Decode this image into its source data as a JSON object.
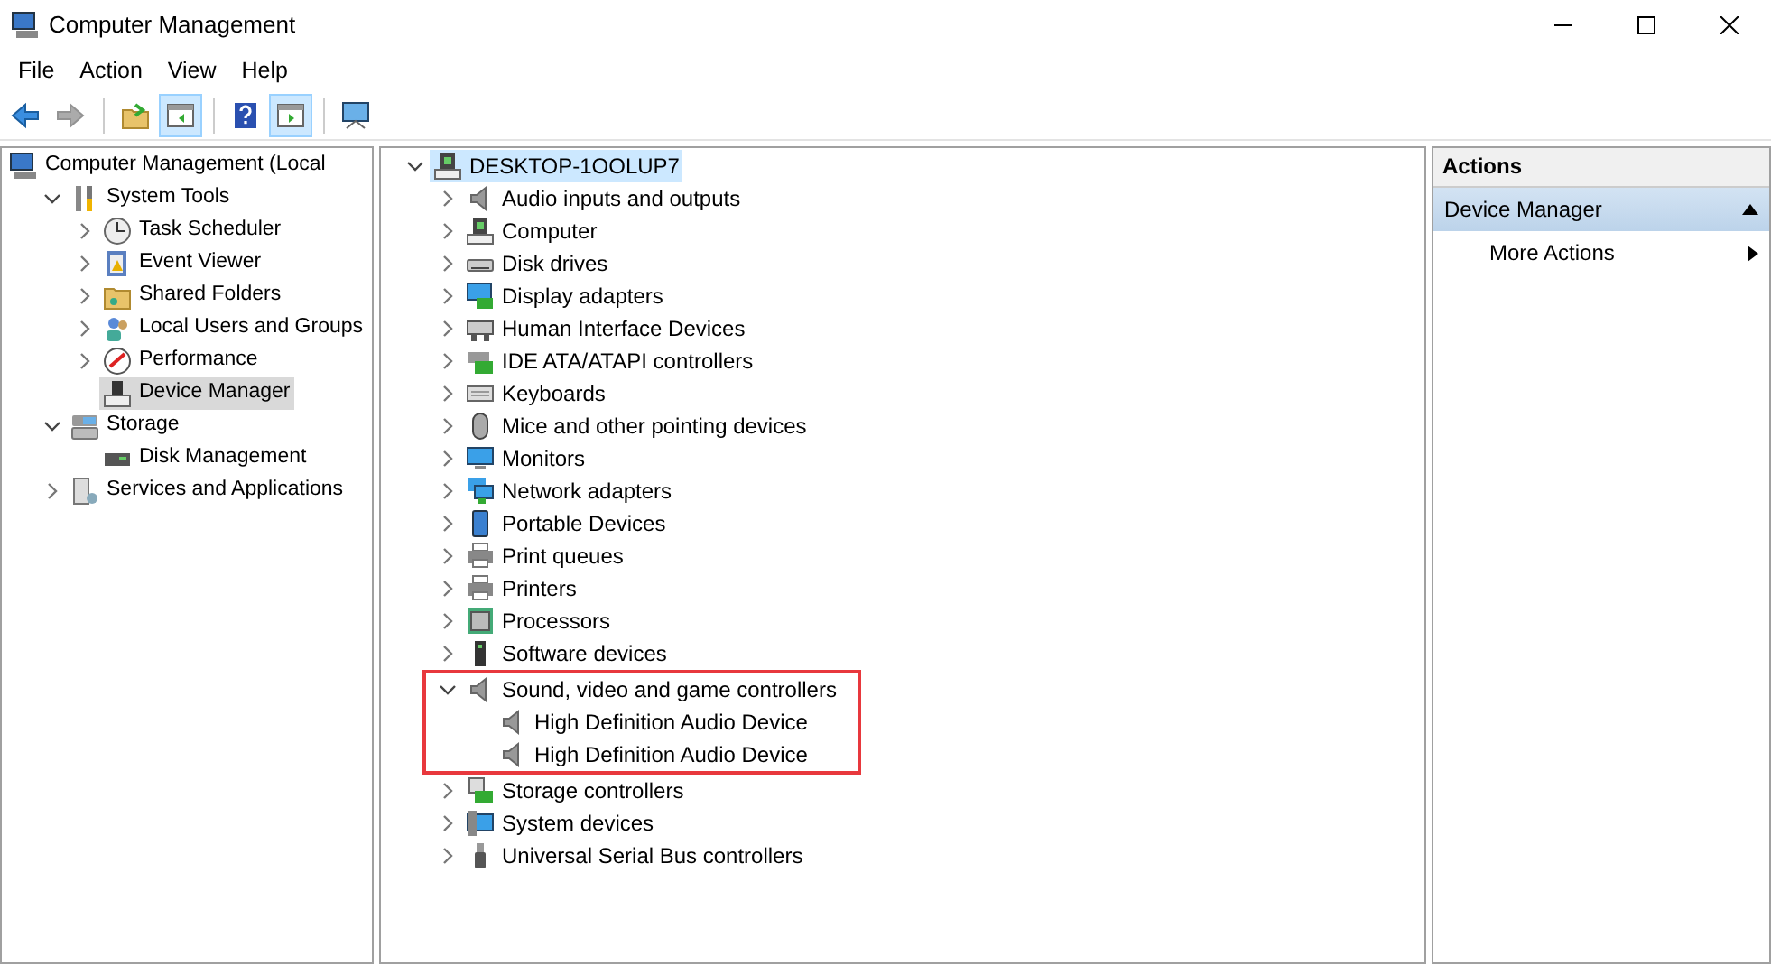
{
  "window": {
    "title": "Computer Management"
  },
  "menu": [
    "File",
    "Action",
    "View",
    "Help"
  ],
  "toolbar": [
    {
      "pressed": false,
      "disabled": false
    },
    {
      "pressed": false,
      "disabled": true
    },
    {
      "pressed": false,
      "disabled": false
    },
    {
      "pressed": true,
      "disabled": false
    },
    {
      "pressed": false,
      "disabled": false
    },
    {
      "pressed": true,
      "disabled": false
    },
    {
      "pressed": false,
      "disabled": false
    }
  ],
  "console_tree": [
    {
      "label": "Computer Management (Local",
      "kind": "root",
      "selected": false,
      "children": [
        {
          "label": "System Tools",
          "kind": "branch",
          "expanded": true,
          "selected": false,
          "children": [
            {
              "label": "Task Scheduler",
              "kind": "branch",
              "expanded": false,
              "selected": false
            },
            {
              "label": "Event Viewer",
              "kind": "branch",
              "expanded": false,
              "selected": false
            },
            {
              "label": "Shared Folders",
              "kind": "branch",
              "expanded": false,
              "selected": false
            },
            {
              "label": "Local Users and Groups",
              "kind": "branch",
              "expanded": false,
              "selected": false
            },
            {
              "label": "Performance",
              "kind": "branch",
              "expanded": false,
              "selected": false
            },
            {
              "label": "Device Manager",
              "kind": "leaf",
              "selected": true
            }
          ]
        },
        {
          "label": "Storage",
          "kind": "branch",
          "expanded": true,
          "selected": false,
          "children": [
            {
              "label": "Disk Management",
              "kind": "leaf",
              "selected": false
            }
          ]
        },
        {
          "label": "Services and Applications",
          "kind": "branch",
          "expanded": false,
          "selected": false
        }
      ]
    }
  ],
  "device_tree": [
    {
      "label": "DESKTOP-1OOLUP7",
      "kind": "branch",
      "expanded": true,
      "selected": true,
      "highlighted": false,
      "children": [
        {
          "label": "Audio inputs and outputs",
          "kind": "branch",
          "expanded": false,
          "selected": false,
          "highlighted": false
        },
        {
          "label": "Computer",
          "kind": "branch",
          "expanded": false,
          "selected": false,
          "highlighted": false
        },
        {
          "label": "Disk drives",
          "kind": "branch",
          "expanded": false,
          "selected": false,
          "highlighted": false
        },
        {
          "label": "Display adapters",
          "kind": "branch",
          "expanded": false,
          "selected": false,
          "highlighted": false
        },
        {
          "label": "Human Interface Devices",
          "kind": "branch",
          "expanded": false,
          "selected": false,
          "highlighted": false
        },
        {
          "label": "IDE ATA/ATAPI controllers",
          "kind": "branch",
          "expanded": false,
          "selected": false,
          "highlighted": false
        },
        {
          "label": "Keyboards",
          "kind": "branch",
          "expanded": false,
          "selected": false,
          "highlighted": false
        },
        {
          "label": "Mice and other pointing devices",
          "kind": "branch",
          "expanded": false,
          "selected": false,
          "highlighted": false
        },
        {
          "label": "Monitors",
          "kind": "branch",
          "expanded": false,
          "selected": false,
          "highlighted": false
        },
        {
          "label": "Network adapters",
          "kind": "branch",
          "expanded": false,
          "selected": false,
          "highlighted": false
        },
        {
          "label": "Portable Devices",
          "kind": "branch",
          "expanded": false,
          "selected": false,
          "highlighted": false
        },
        {
          "label": "Print queues",
          "kind": "branch",
          "expanded": false,
          "selected": false,
          "highlighted": false
        },
        {
          "label": "Printers",
          "kind": "branch",
          "expanded": false,
          "selected": false,
          "highlighted": false
        },
        {
          "label": "Processors",
          "kind": "branch",
          "expanded": false,
          "selected": false,
          "highlighted": false
        },
        {
          "label": "Software devices",
          "kind": "branch",
          "expanded": false,
          "selected": false,
          "highlighted": false
        },
        {
          "label": "Sound, video and game controllers",
          "kind": "branch",
          "expanded": true,
          "selected": false,
          "highlighted": true,
          "children": [
            {
              "label": "High Definition Audio Device",
              "kind": "leaf",
              "selected": false
            },
            {
              "label": "High Definition Audio Device",
              "kind": "leaf",
              "selected": false
            }
          ]
        },
        {
          "label": "Storage controllers",
          "kind": "branch",
          "expanded": false,
          "selected": false,
          "highlighted": false
        },
        {
          "label": "System devices",
          "kind": "branch",
          "expanded": false,
          "selected": false,
          "highlighted": false
        },
        {
          "label": "Universal Serial Bus controllers",
          "kind": "branch",
          "expanded": false,
          "selected": false,
          "highlighted": false
        }
      ]
    }
  ],
  "actions": {
    "header": "Actions",
    "items": [
      {
        "label": "Device Manager",
        "kind": "section",
        "expanded": true
      },
      {
        "label": "More Actions",
        "kind": "submenu",
        "expanded": false
      }
    ]
  }
}
